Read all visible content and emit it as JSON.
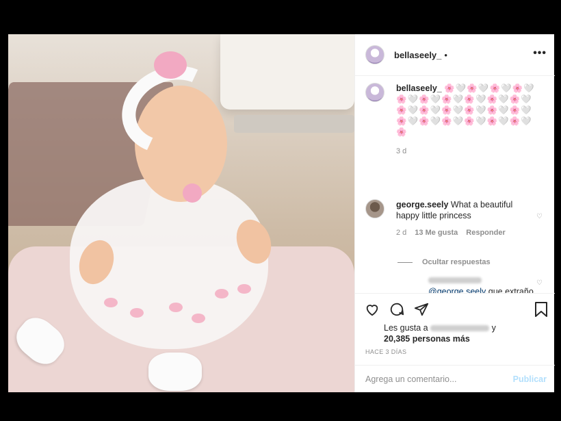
{
  "post": {
    "author": "bellaseely_",
    "header_dot": "•",
    "more_icon": "more-icon",
    "caption": {
      "username": "bellaseely_",
      "emojis": "🌸🤍🌸🤍🌸🤍🌸🤍🌸🤍🌸🤍🌸🤍🌸🤍🌸🤍🌸🤍🌸🤍🌸🤍🌸🤍🌸🤍🌸🤍🌸🤍🌸🤍🌸🤍🌸🤍🌸🤍🌸🤍🌸🤍🌸",
      "time": "3 d"
    },
    "comments": [
      {
        "username": "george.seely",
        "text": "What a beautiful happy little princess",
        "time": "2 d",
        "likes": "13 Me gusta",
        "reply_label": "Responder"
      }
    ],
    "hide_replies": "Ocultar respuestas",
    "reply": {
      "mention": "@george.seely",
      "text": "que extraño que comenté fotos de la hija que nisiquiera sigue y peor"
    },
    "likes": {
      "prefix": "Les gusta a",
      "suffix": "y",
      "count": "20,385 personas más"
    },
    "timestamp": "HACE 3 DÍAS",
    "comment_input": {
      "placeholder": "Agrega un comentario...",
      "value": ""
    },
    "publish_label": "Publicar"
  },
  "colors": {
    "publish_disabled": "#b2dffc",
    "mention": "#00376b",
    "meta": "#8e8e8e"
  }
}
